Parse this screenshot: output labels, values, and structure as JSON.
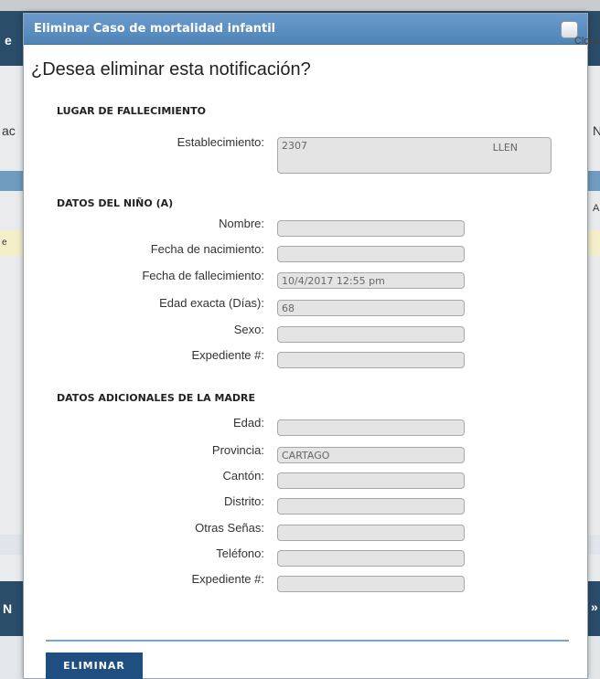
{
  "background": {
    "edge_left": [
      "e",
      "ac",
      "e",
      "N"
    ],
    "edge_right": [
      "N",
      "A",
      "»"
    ]
  },
  "modal": {
    "title": "Eliminar Caso de mortalidad infantil",
    "close_label": "Close",
    "heading": "¿Desea eliminar esta notificación?",
    "sections": {
      "lugar": "LUGAR DE FALLECIMIENTO",
      "nino": "DATOS DEL NIÑO (A)",
      "madre": "DATOS ADICIONALES DE LA MADRE"
    },
    "lugar_fields": {
      "establecimiento": {
        "label": "Establecimiento:",
        "value": "2307",
        "value_right": "LLEN"
      }
    },
    "nino_fields": {
      "nombre": {
        "label": "Nombre:",
        "value": ""
      },
      "fecha_nacimiento": {
        "label": "Fecha de nacimiento:",
        "value": ""
      },
      "fecha_fallecimiento": {
        "label": "Fecha de fallecimiento:",
        "value": "10/4/2017 12:55 pm"
      },
      "edad_exacta": {
        "label": "Edad exacta (Días):",
        "value": "68"
      },
      "sexo": {
        "label": "Sexo:",
        "value": ""
      },
      "expediente": {
        "label": "Expediente #:",
        "value": ""
      }
    },
    "madre_fields": {
      "edad": {
        "label": "Edad:",
        "value": ""
      },
      "provincia": {
        "label": "Provincia:",
        "value": "CARTAGO"
      },
      "canton": {
        "label": "Cantón:",
        "value": ""
      },
      "distrito": {
        "label": "Distrito:",
        "value": ""
      },
      "otras_senas": {
        "label": "Otras Señas:",
        "value": ""
      },
      "telefono": {
        "label": "Teléfono:",
        "value": ""
      },
      "expediente": {
        "label": "Expediente #:",
        "value": ""
      }
    },
    "delete_button": "ELIMINAR"
  }
}
